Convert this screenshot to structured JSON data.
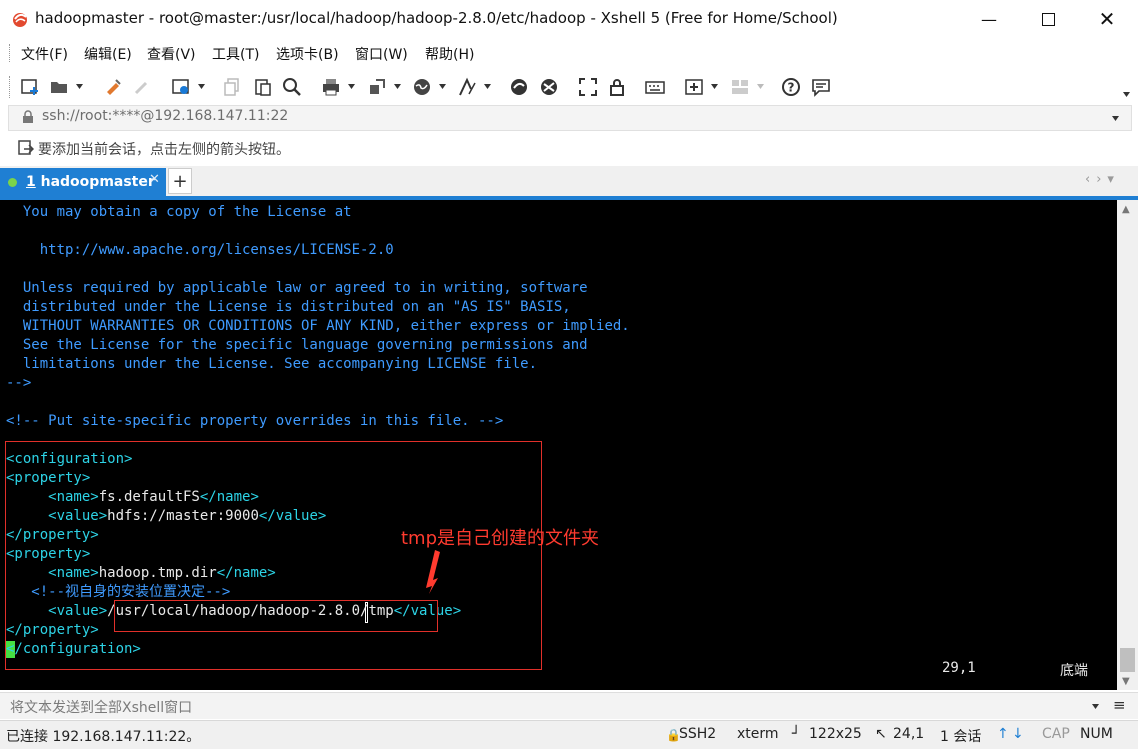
{
  "window": {
    "title": "hadoopmaster - root@master:/usr/local/hadoop/hadoop-2.8.0/etc/hadoop - Xshell 5 (Free for Home/School)"
  },
  "menu": [
    "文件(F)",
    "编辑(E)",
    "查看(V)",
    "工具(T)",
    "选项卡(B)",
    "窗口(W)",
    "帮助(H)"
  ],
  "toolbar_icons": [
    "new-session-icon",
    "open-folder-icon",
    "reconnect-icon",
    "disconnect-icon",
    "properties-icon",
    "copy-icon",
    "paste-icon",
    "find-icon",
    "print-icon",
    "transfer-icon",
    "globe-icon",
    "font-icon",
    "xftp-icon",
    "xmanager-icon",
    "fullscreen-icon",
    "lock-icon",
    "keyboard-icon",
    "add-panel-icon",
    "layout-icon",
    "help-icon",
    "chat-icon"
  ],
  "address": {
    "value": "ssh://root:****@192.168.147.11:22"
  },
  "hint": "要添加当前会话，点击左侧的箭头按钮。",
  "tabs": [
    {
      "number": "1",
      "name": "hadoopmaster",
      "active": true,
      "status_color": "#7bd44b"
    }
  ],
  "terminal": {
    "lines": [
      {
        "text": "  You may obtain a copy of the License at",
        "color": "blue"
      },
      {
        "text": "",
        "color": "blue"
      },
      {
        "text": "    http://www.apache.org/licenses/LICENSE-2.0",
        "color": "blue"
      },
      {
        "text": "",
        "color": "blue"
      },
      {
        "text": "  Unless required by applicable law or agreed to in writing, software",
        "color": "blue"
      },
      {
        "text": "  distributed under the License is distributed on an \"AS IS\" BASIS,",
        "color": "blue"
      },
      {
        "text": "  WITHOUT WARRANTIES OR CONDITIONS OF ANY KIND, either express or implied.",
        "color": "blue"
      },
      {
        "text": "  See the License for the specific language governing permissions and",
        "color": "blue"
      },
      {
        "text": "  limitations under the License. See accompanying LICENSE file.",
        "color": "blue"
      },
      {
        "text": "-->",
        "color": "blue"
      },
      {
        "text": "",
        "color": "blue"
      },
      {
        "text": "<!-- Put site-specific property overrides in this file. -->",
        "color": "blue"
      },
      {
        "text": "",
        "color": "blue"
      },
      {
        "text": "<configuration>",
        "color": "green"
      },
      {
        "text": "<property>",
        "color": "green"
      },
      {
        "text": "     <name>",
        "color": "green",
        "mid": "fs.defaultFS",
        "tail": "</name>"
      },
      {
        "text": "     <value>",
        "color": "green",
        "mid": "hdfs://master:9000",
        "tail": "</value>"
      },
      {
        "text": "</property>",
        "color": "green"
      },
      {
        "text": "<property>",
        "color": "green"
      },
      {
        "text": "     <name>",
        "color": "green",
        "mid": "hadoop.tmp.dir",
        "tail": "</name>"
      },
      {
        "text": "   <!--视自身的安装位置决定-->",
        "color": "blue"
      },
      {
        "text": "     <value>",
        "color": "green",
        "mid": "/usr/local/hadoop/hadoop-2.8.0/tmp",
        "tail": "</value>"
      },
      {
        "text": "</property>",
        "color": "green"
      },
      {
        "text": "</configuration>",
        "color": "green"
      }
    ],
    "vim_position": "29,1",
    "vim_scroll": "底端",
    "annotation": "tmp是自己创建的文件夹"
  },
  "compose_placeholder": "将文本发送到全部Xshell窗口",
  "status": {
    "connection": "已连接 192.168.147.11:22。",
    "protocol": "SSH2",
    "terminal_type": "xterm",
    "size": "122x25",
    "cursor": "24,1",
    "sessions": "1 会话",
    "caps": "CAP",
    "num": "NUM"
  },
  "colors": {
    "accent": "#1f7fd3",
    "terminal_bg": "#000000",
    "annotation": "#ff3b2f"
  }
}
